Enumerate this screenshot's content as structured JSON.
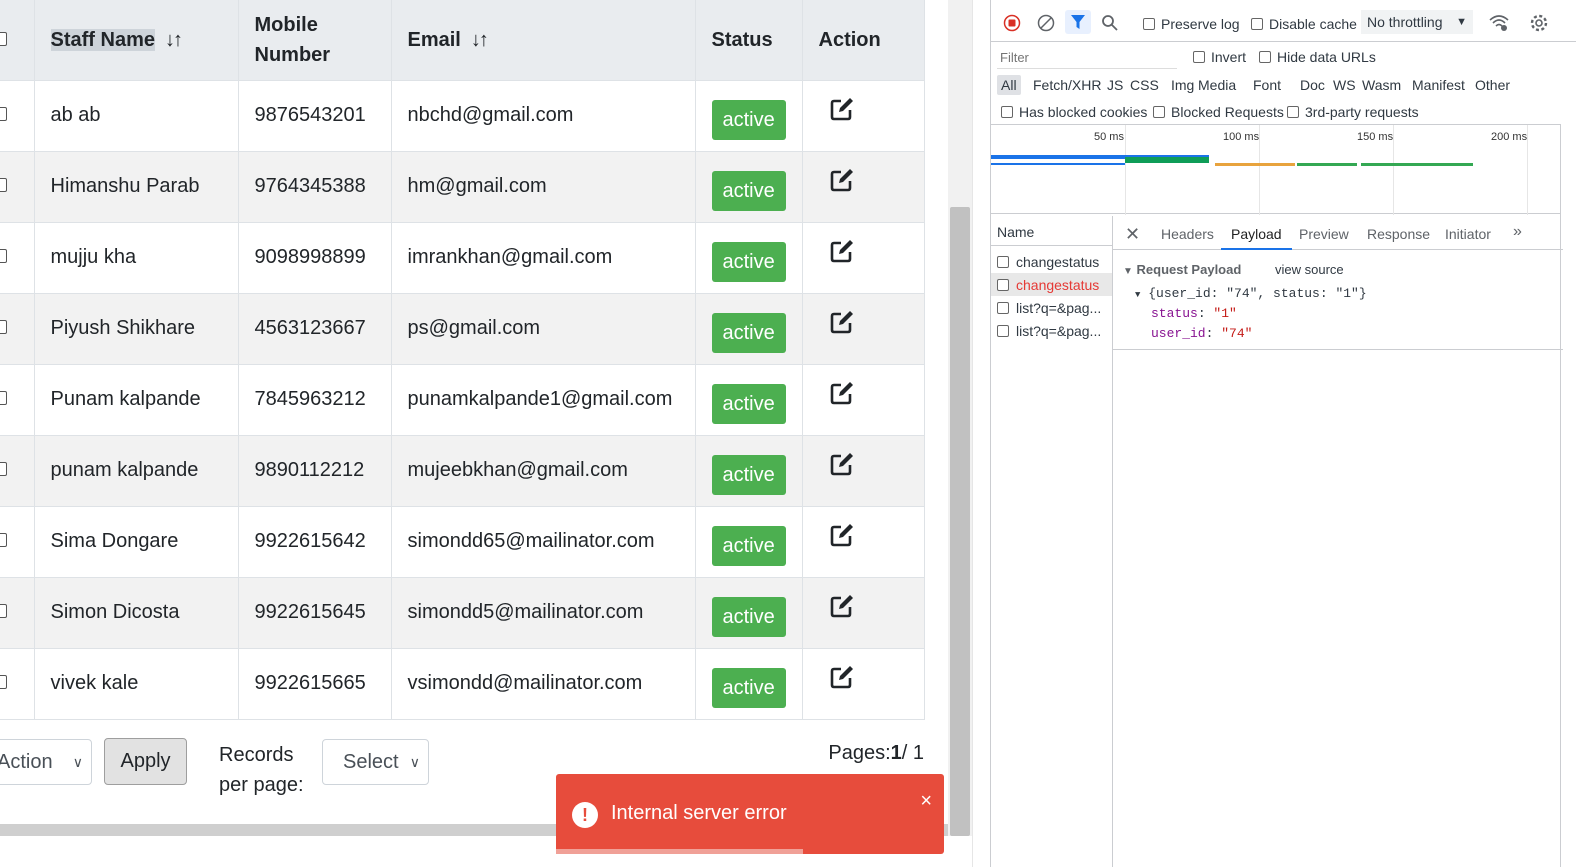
{
  "table": {
    "headers": {
      "staff_name": "Staff Name",
      "mobile_line1": "Mobile",
      "mobile_line2": "Number",
      "email": "Email",
      "status": "Status",
      "action": "Action",
      "sort_glyph": "↓↑"
    },
    "rows": [
      {
        "name": "ab ab",
        "mobile": "9876543201",
        "email": "nbchd@gmail.com",
        "status": "active"
      },
      {
        "name": "Himanshu Parab",
        "mobile": "9764345388",
        "email": "hm@gmail.com",
        "status": "active"
      },
      {
        "name": "mujju kha",
        "mobile": "9098998899",
        "email": "imrankhan@gmail.com",
        "status": "active"
      },
      {
        "name": "Piyush Shikhare",
        "mobile": "4563123667",
        "email": "ps@gmail.com",
        "status": "active"
      },
      {
        "name": "Punam kalpande",
        "mobile": "7845963212",
        "email": "punamkalpande1@gmail.com",
        "status": "active"
      },
      {
        "name": "punam kalpande",
        "mobile": "9890112212",
        "email": "mujeebkhan@gmail.com",
        "status": "active"
      },
      {
        "name": "Sima Dongare",
        "mobile": "9922615642",
        "email": "simondd65@mailinator.com",
        "status": "active"
      },
      {
        "name": "Simon Dicosta",
        "mobile": "9922615645",
        "email": "simondd5@mailinator.com",
        "status": "active"
      },
      {
        "name": "vivek kale",
        "mobile": "9922615665",
        "email": "vsimondd@mailinator.com",
        "status": "active"
      }
    ]
  },
  "controls": {
    "action_select": "Action",
    "apply_label": "Apply",
    "records_label_line1": "Records",
    "records_label_line2": "per page:",
    "per_page_select": "Select",
    "pages_label": "Pages:",
    "pages_current": "1",
    "pages_total": "/ 1"
  },
  "toast": {
    "message": "Internal server error",
    "icon": "!",
    "close": "×",
    "color": "#e74c3c"
  },
  "devtools": {
    "toolbar": {
      "preserve_log": "Preserve log",
      "disable_cache": "Disable cache",
      "throttling": "No throttling"
    },
    "filter_placeholder": "Filter",
    "invert": "Invert",
    "hide_data_urls": "Hide data URLs",
    "types": [
      "All",
      "Fetch/XHR",
      "JS",
      "CSS",
      "Img",
      "Media",
      "Font",
      "Doc",
      "WS",
      "Wasm",
      "Manifest",
      "Other"
    ],
    "has_blocked_cookies": "Has blocked cookies",
    "blocked_requests": "Blocked Requests",
    "third_party": "3rd-party requests",
    "timeline_ticks": [
      "50 ms",
      "100 ms",
      "150 ms",
      "200 ms"
    ],
    "name_header": "Name",
    "requests": [
      "changestatus",
      "changestatus",
      "list?q=&pag...",
      "list?q=&pag..."
    ],
    "tabs": [
      "Headers",
      "Payload",
      "Preview",
      "Response",
      "Initiator"
    ],
    "payload": {
      "section": "Request Payload",
      "view_source": "view source",
      "summary": "{user_id: \"74\", status: \"1\"}",
      "status_key": "status",
      "status_value": "\"1\"",
      "user_id_key": "user_id",
      "user_id_value": "\"74\""
    }
  }
}
